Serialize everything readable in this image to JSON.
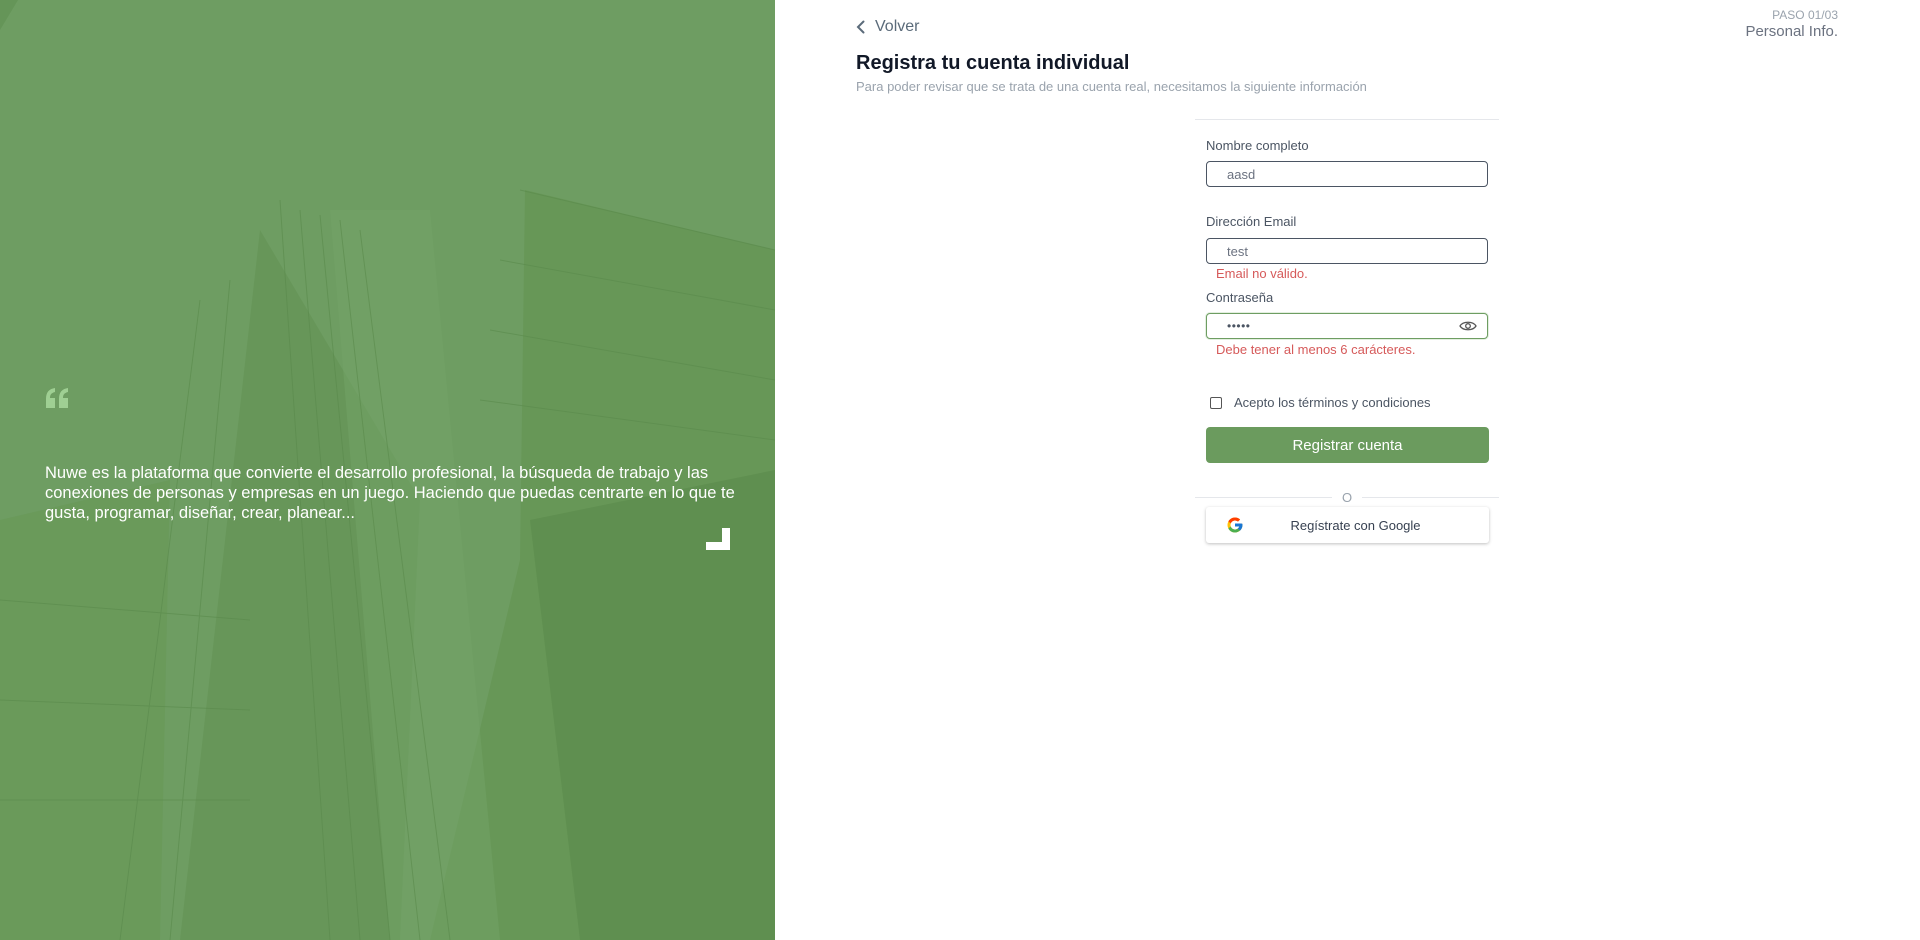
{
  "hero": {
    "quote": "Nuwe es la plataforma que convierte el desarrollo profesional, la búsqueda de trabajo y las conexiones de personas y empresas en un juego. Haciendo que puedas centrarte en lo que te gusta, programar, diseñar, crear, planear..."
  },
  "nav": {
    "back_label": "Volver",
    "step": "PASO 01/03",
    "step_name": "Personal Info."
  },
  "header": {
    "title": "Registra tu cuenta individual",
    "subtitle": "Para poder revisar que se trata de una cuenta real, necesitamos la siguiente información"
  },
  "form": {
    "name": {
      "label": "Nombre completo",
      "value": "aasd"
    },
    "email": {
      "label": "Dirección Email",
      "value": "test",
      "error": "Email no válido."
    },
    "password": {
      "label": "Contraseña",
      "masked_value": "•••••",
      "error": "Debe tener al menos 6 carácteres."
    },
    "terms_label": "Acepto los términos y condiciones",
    "terms_checked": false,
    "submit_label": "Registrar cuenta",
    "divider_label": "O",
    "google_label": "Regístrate con Google"
  },
  "colors": {
    "brand_green": "#6b9b5e",
    "error_red": "#d65a5a"
  },
  "icons": [
    "chevron-left-icon",
    "quote-icon",
    "eye-icon",
    "google-icon",
    "corner-icon"
  ]
}
